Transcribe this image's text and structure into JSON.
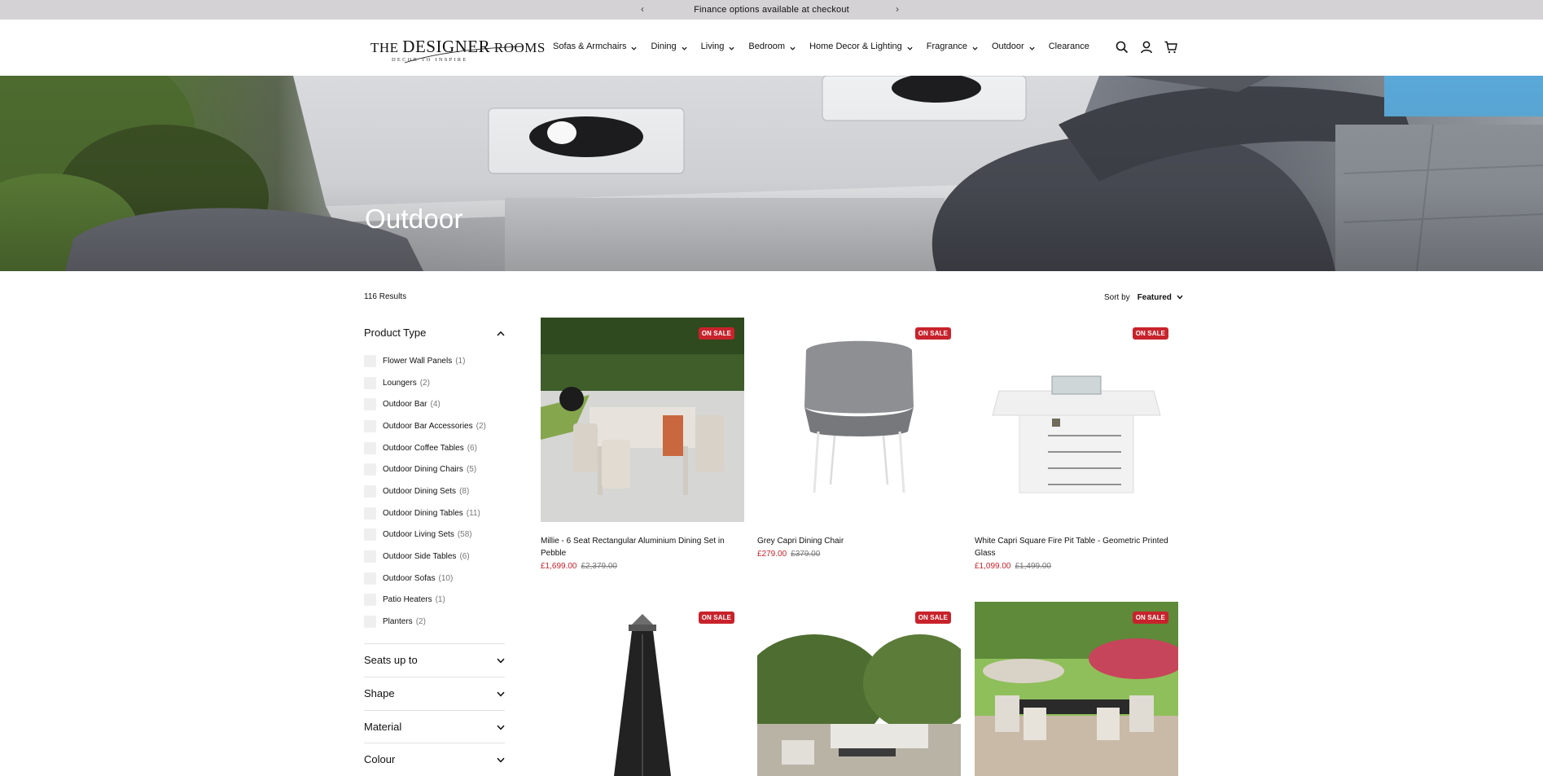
{
  "announcement": {
    "text": "Finance options available at checkout",
    "prev": "‹",
    "next": "›"
  },
  "brand": {
    "line1_a": "THE ",
    "line1_b": "DESIGNER",
    "line1_c": " ROOMS",
    "tagline": "DECOR TO INSPIRE"
  },
  "nav": [
    {
      "label": "Sofas & Armchairs",
      "dropdown": true
    },
    {
      "label": "Dining",
      "dropdown": true
    },
    {
      "label": "Living",
      "dropdown": true
    },
    {
      "label": "Bedroom",
      "dropdown": true
    },
    {
      "label": "Home Decor & Lighting",
      "dropdown": true
    },
    {
      "label": "Fragrance",
      "dropdown": true
    },
    {
      "label": "Outdoor",
      "dropdown": true
    },
    {
      "label": "Clearance",
      "dropdown": false
    }
  ],
  "header_icons": [
    "search-icon",
    "account-icon",
    "cart-icon"
  ],
  "hero": {
    "title": "Outdoor"
  },
  "listing": {
    "results": "116 Results",
    "sort_label": "Sort by",
    "sort_value": "Featured"
  },
  "filters": {
    "product_type": {
      "title": "Product Type",
      "options": [
        {
          "label": "Flower Wall Panels",
          "count": "(1)"
        },
        {
          "label": "Loungers",
          "count": "(2)"
        },
        {
          "label": "Outdoor Bar",
          "count": "(4)"
        },
        {
          "label": "Outdoor Bar Accessories",
          "count": "(2)"
        },
        {
          "label": "Outdoor Coffee Tables",
          "count": "(6)"
        },
        {
          "label": "Outdoor Dining Chairs",
          "count": "(5)"
        },
        {
          "label": "Outdoor Dining Sets",
          "count": "(8)"
        },
        {
          "label": "Outdoor Dining Tables",
          "count": "(11)"
        },
        {
          "label": "Outdoor Living Sets",
          "count": "(58)"
        },
        {
          "label": "Outdoor Side Tables",
          "count": "(6)"
        },
        {
          "label": "Outdoor Sofas",
          "count": "(10)"
        },
        {
          "label": "Patio Heaters",
          "count": "(1)"
        },
        {
          "label": "Planters",
          "count": "(2)"
        }
      ]
    },
    "groups": [
      "Seats up to",
      "Shape",
      "Material",
      "Colour"
    ]
  },
  "products": [
    {
      "badge": "ON SALE",
      "name": "Millie - 6 Seat Rectangular Aluminium Dining Set in Pebble",
      "price": "£1,699.00",
      "was": "£2,379.00"
    },
    {
      "badge": "ON SALE",
      "name": "Grey Capri Dining Chair",
      "price": "£279.00",
      "was": "£379.00"
    },
    {
      "badge": "ON SALE",
      "name": "White Capri Square Fire Pit Table - Geometric Printed Glass",
      "price": "£1,099.00",
      "was": "£1,499.00"
    },
    {
      "badge": "ON SALE"
    },
    {
      "badge": "ON SALE"
    },
    {
      "badge": "ON SALE"
    }
  ],
  "colors": {
    "sale_red": "#c8232c",
    "announce_bg": "#d4d2d4"
  }
}
